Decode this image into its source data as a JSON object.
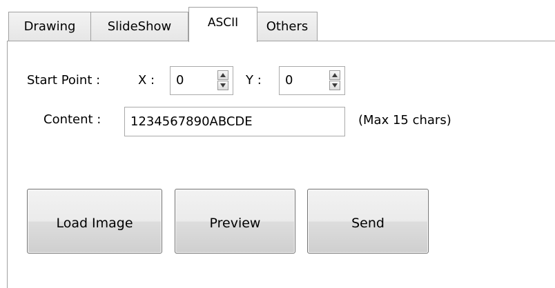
{
  "tabs": [
    {
      "label": "Drawing"
    },
    {
      "label": "SlideShow"
    },
    {
      "label": "ASCII"
    },
    {
      "label": "Others"
    }
  ],
  "active_tab": "ASCII",
  "start_point": {
    "label": "Start Point :",
    "x_label": "X :",
    "x_value": "0",
    "y_label": "Y :",
    "y_value": "0"
  },
  "content": {
    "label": "Content :",
    "value": "1234567890ABCDE",
    "hint": "(Max 15 chars)"
  },
  "buttons": {
    "load_image": "Load Image",
    "preview": "Preview",
    "send": "Send"
  },
  "icons": {
    "spin_up": "triangle-up-icon",
    "spin_down": "triangle-down-icon"
  },
  "colors": {
    "border": "#a0a0a0",
    "button_border": "#707070",
    "background": "#ffffff"
  }
}
